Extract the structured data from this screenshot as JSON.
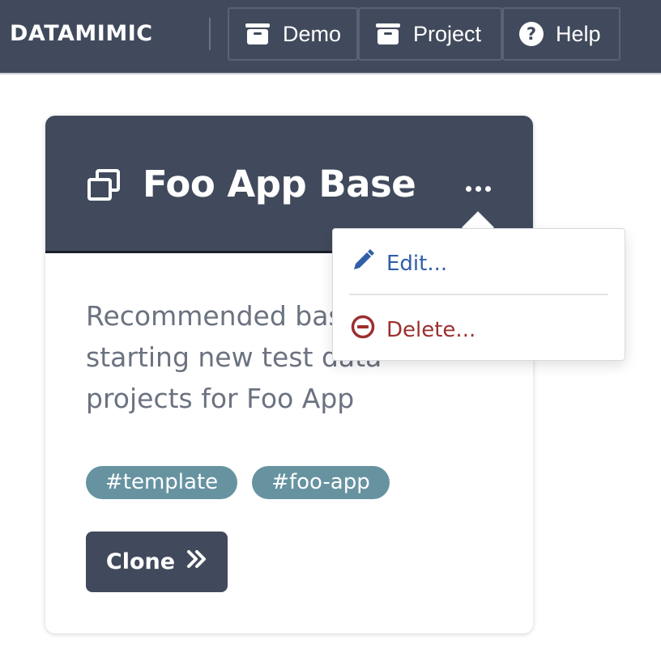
{
  "nav": {
    "brand": "DATAMIMIC",
    "items": [
      {
        "label": "Demo",
        "icon": "archive-box-icon"
      },
      {
        "label": "Project",
        "icon": "archive-box-icon"
      },
      {
        "label": "Help",
        "icon": "question-circle-icon"
      }
    ]
  },
  "card": {
    "icon": "copy-icon",
    "title": "Foo App Base",
    "description": "Recommended base for starting new test data projects for Foo App",
    "tags": [
      "#template",
      "#foo-app"
    ],
    "clone_label": "Clone"
  },
  "dropdown": {
    "edit_label": "Edit...",
    "delete_label": "Delete..."
  },
  "colors": {
    "navbar": "#414a5c",
    "tag": "#6793a1",
    "edit": "#2f5fa8",
    "delete": "#9c2f2f"
  }
}
